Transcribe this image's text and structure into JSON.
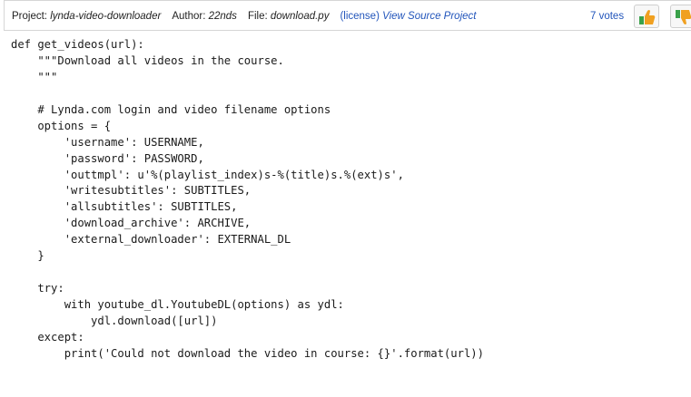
{
  "header": {
    "project_label": "Project:",
    "project_value": "lynda-video-downloader",
    "author_label": "Author:",
    "author_value": "22nds",
    "file_label": "File:",
    "file_value": "download.py",
    "license_link": "(license)",
    "view_source_link": "View Source Project",
    "votes": "7 votes"
  },
  "icons": {
    "upvote": "thumbs-up-icon",
    "downvote": "thumbs-down-icon"
  },
  "colors": {
    "link": "#2255bb",
    "thumb_orange": "#f0a020",
    "thumb_green": "#3aa14a"
  },
  "code_lines": [
    "def get_videos(url):",
    "    \"\"\"Download all videos in the course.",
    "    \"\"\"",
    "",
    "    # Lynda.com login and video filename options",
    "    options = {",
    "        'username': USERNAME,",
    "        'password': PASSWORD,",
    "        'outtmpl': u'%(playlist_index)s-%(title)s.%(ext)s',",
    "        'writesubtitles': SUBTITLES,",
    "        'allsubtitles': SUBTITLES,",
    "        'download_archive': ARCHIVE,",
    "        'external_downloader': EXTERNAL_DL",
    "    }",
    "",
    "    try:",
    "        with youtube_dl.YoutubeDL(options) as ydl:",
    "            ydl.download([url])",
    "    except:",
    "        print('Could not download the video in course: {}'.format(url))"
  ]
}
